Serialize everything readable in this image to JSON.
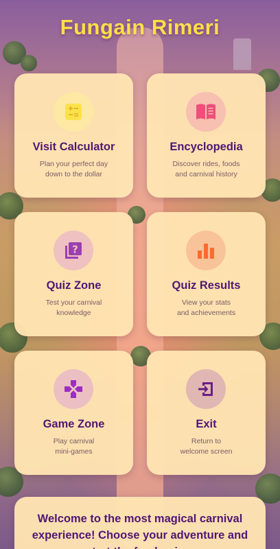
{
  "app": {
    "title": "Fungain Rimeri"
  },
  "menu": [
    {
      "id": "visit-calculator",
      "title": "Visit Calculator",
      "desc_line1": "Plan your perfect day",
      "desc_line2": "down to the dollar",
      "icon": "calculator-icon",
      "icon_color": "#fbe24a",
      "icon_bg": "#fde9a4"
    },
    {
      "id": "encyclopedia",
      "title": "Encyclopedia",
      "desc_line1": "Discover rides, foods",
      "desc_line2": "and carnival history",
      "icon": "book-icon",
      "icon_color": "#ef4e7a",
      "icon_bg": "#f7c0b0"
    },
    {
      "id": "quiz-zone",
      "title": "Quiz Zone",
      "desc_line1": "Test your carnival",
      "desc_line2": "knowledge",
      "icon": "quiz-icon",
      "icon_color": "#9b3fb0",
      "icon_bg": "#efc1c0"
    },
    {
      "id": "quiz-results",
      "title": "Quiz Results",
      "desc_line1": "View your stats",
      "desc_line2": "and achievements",
      "icon": "bar-chart-icon",
      "icon_color": "#ff6b2c",
      "icon_bg": "#f9c39a"
    },
    {
      "id": "game-zone",
      "title": "Game Zone",
      "desc_line1": "Play carnival",
      "desc_line2": "mini-games",
      "icon": "gamepad-icon",
      "icon_color": "#9b2ec0",
      "icon_bg": "#ecbfc2"
    },
    {
      "id": "exit",
      "title": "Exit",
      "desc_line1": "Return to",
      "desc_line2": "welcome screen",
      "icon": "exit-icon",
      "icon_color": "#6b1f86",
      "icon_bg": "#e0b7b2"
    }
  ],
  "welcome": {
    "line1": "Welcome to the most magical carnival",
    "line2": "experience! Choose your adventure and",
    "line3": "start the fun begin..."
  }
}
